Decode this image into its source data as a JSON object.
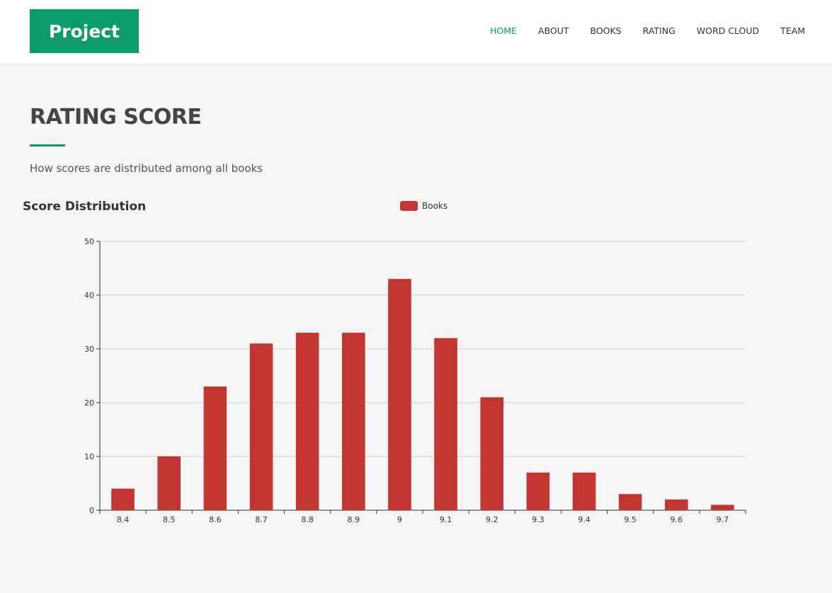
{
  "header": {
    "logo": "Project",
    "nav": [
      {
        "label": "HOME",
        "active": true
      },
      {
        "label": "ABOUT",
        "active": false
      },
      {
        "label": "BOOKS",
        "active": false
      },
      {
        "label": "RATING",
        "active": false
      },
      {
        "label": "WORD CLOUD",
        "active": false
      },
      {
        "label": "TEAM",
        "active": false
      }
    ]
  },
  "section": {
    "title": "RATING SCORE",
    "subtitle": "How scores are distributed among all books"
  },
  "colors": {
    "accent": "#0d9a6c",
    "bar": "#c23531"
  },
  "chart_data": {
    "type": "bar",
    "title": "Score Distribution",
    "legend": [
      "Books"
    ],
    "legend_position": "top-center",
    "categories": [
      "8.4",
      "8.5",
      "8.6",
      "8.7",
      "8.8",
      "8.9",
      "9",
      "9.1",
      "9.2",
      "9.3",
      "9.4",
      "9.5",
      "9.6",
      "9.7"
    ],
    "series": [
      {
        "name": "Books",
        "values": [
          4,
          10,
          23,
          31,
          33,
          33,
          43,
          32,
          21,
          7,
          7,
          3,
          2,
          1
        ]
      }
    ],
    "ylim": [
      0,
      50
    ],
    "yticks": [
      0,
      10,
      20,
      30,
      40,
      50
    ],
    "grid": true
  }
}
